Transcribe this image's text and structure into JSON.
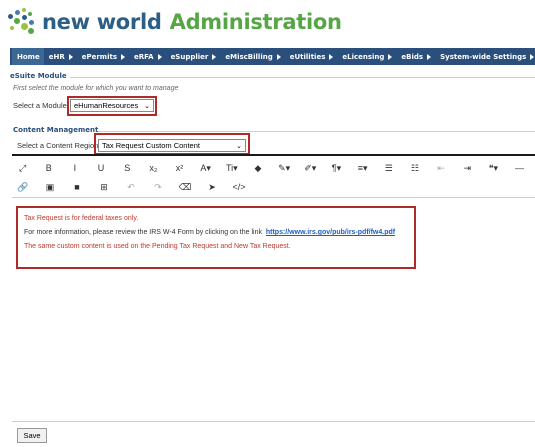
{
  "header": {
    "brand": "new world",
    "subtitle": "Administration",
    "logo_colors": [
      "#2d5f86",
      "#56a646",
      "#9ac43d",
      "#4b7aa8"
    ]
  },
  "nav": {
    "items": [
      {
        "label": "Home"
      },
      {
        "label": "eHR"
      },
      {
        "label": "ePermits"
      },
      {
        "label": "eRFA"
      },
      {
        "label": "eSupplier"
      },
      {
        "label": "eMiscBilling"
      },
      {
        "label": "eUtilities"
      },
      {
        "label": "eLicensing"
      },
      {
        "label": "eBids"
      },
      {
        "label": "System-wide Settings"
      }
    ]
  },
  "esuite": {
    "title": "eSuite Module",
    "hint": "First select the module for which you want to manage",
    "label": "Select a Module:",
    "value": "eHumanResources"
  },
  "content_management": {
    "title": "Content Management",
    "label": "Select a Content Region",
    "value": "Tax Request Custom Content"
  },
  "toolbar": {
    "row1": [
      {
        "name": "fullscreen-icon",
        "glyph": "⤢"
      },
      {
        "name": "bold-icon",
        "glyph": "B"
      },
      {
        "name": "italic-icon",
        "glyph": "I"
      },
      {
        "name": "underline-icon",
        "glyph": "U"
      },
      {
        "name": "strikethrough-icon",
        "glyph": "S"
      },
      {
        "name": "subscript-icon",
        "glyph": "x₂"
      },
      {
        "name": "superscript-icon",
        "glyph": "x²"
      },
      {
        "name": "font-size-icon",
        "glyph": "A▾"
      },
      {
        "name": "text-style-icon",
        "glyph": "Ti▾"
      },
      {
        "name": "color-fill-icon",
        "glyph": "◆"
      },
      {
        "name": "text-color-icon",
        "glyph": "✎▾"
      },
      {
        "name": "highlight-icon",
        "glyph": "✐▾"
      },
      {
        "name": "paragraph-icon",
        "glyph": "¶▾"
      },
      {
        "name": "align-icon",
        "glyph": "≡▾"
      },
      {
        "name": "ordered-list-icon",
        "glyph": "☰"
      },
      {
        "name": "unordered-list-icon",
        "glyph": "☷"
      },
      {
        "name": "outdent-icon",
        "glyph": "⇤"
      },
      {
        "name": "indent-icon",
        "glyph": "⇥"
      },
      {
        "name": "quote-icon",
        "glyph": "❝▾"
      },
      {
        "name": "horizontal-rule-icon",
        "glyph": "―"
      }
    ],
    "row2": [
      {
        "name": "link-icon",
        "glyph": "🔗"
      },
      {
        "name": "image-icon",
        "glyph": "▣"
      },
      {
        "name": "video-icon",
        "glyph": "■"
      },
      {
        "name": "table-icon",
        "glyph": "⊞"
      },
      {
        "name": "undo-icon",
        "glyph": "↶"
      },
      {
        "name": "redo-icon",
        "glyph": "↷"
      },
      {
        "name": "clear-format-icon",
        "glyph": "⌫"
      },
      {
        "name": "select-all-icon",
        "glyph": "➤"
      },
      {
        "name": "code-view-icon",
        "glyph": "</>"
      }
    ]
  },
  "editor": {
    "line1": "Tax Request is for federal taxes only.",
    "line2_prefix": "For more information, please review the IRS W-4 Form by clicking on the link",
    "line2_link": "https://www.irs.gov/pub/irs-pdf/fw4.pdf",
    "line3": "The same custom content is  used on the Pending Tax Request and New Tax Request."
  },
  "actions": {
    "save_label": "Save"
  },
  "colors": {
    "nav_bg": "#2a4f7d",
    "highlight_border": "#b02a2a",
    "red_text": "#c0392b",
    "link": "#1f5fbf"
  }
}
